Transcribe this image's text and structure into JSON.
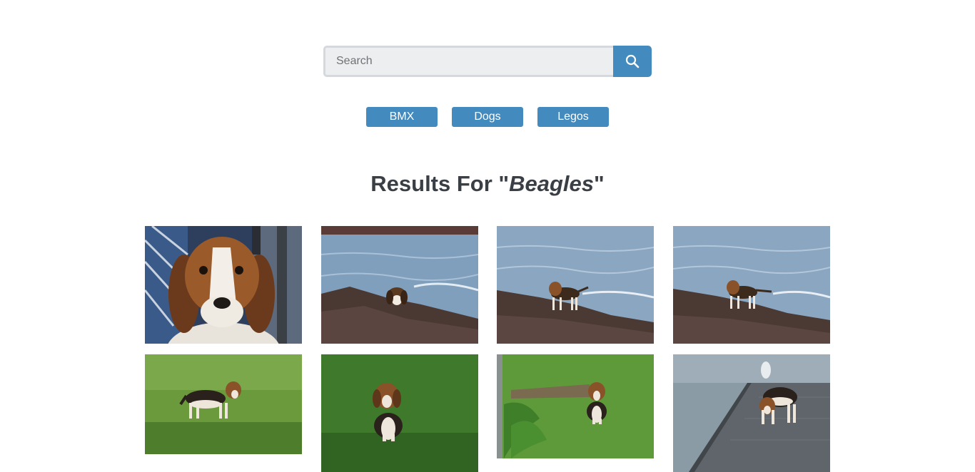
{
  "search": {
    "placeholder": "Search",
    "value": "",
    "button_icon": "search-icon"
  },
  "nav": {
    "items": [
      {
        "label": "BMX"
      },
      {
        "label": "Dogs"
      },
      {
        "label": "Legos"
      }
    ]
  },
  "results": {
    "heading_prefix": "Results For \"",
    "query": "Beagles",
    "heading_suffix": "\""
  },
  "colors": {
    "accent": "#438bbf",
    "heading": "#3a3f46",
    "input_bg": "#edeef0"
  },
  "photos": [
    {
      "subject": "beagle-portrait-closeup"
    },
    {
      "subject": "beagle-on-rocks-by-sea"
    },
    {
      "subject": "beagle-standing-on-rocks-by-sea"
    },
    {
      "subject": "beagle-walking-on-rocks-by-sea"
    },
    {
      "subject": "beagle-standing-on-grass"
    },
    {
      "subject": "beagle-sitting-on-grass"
    },
    {
      "subject": "beagle-sitting-on-grass-near-fence"
    },
    {
      "subject": "beagle-on-pier-with-seagull"
    }
  ]
}
